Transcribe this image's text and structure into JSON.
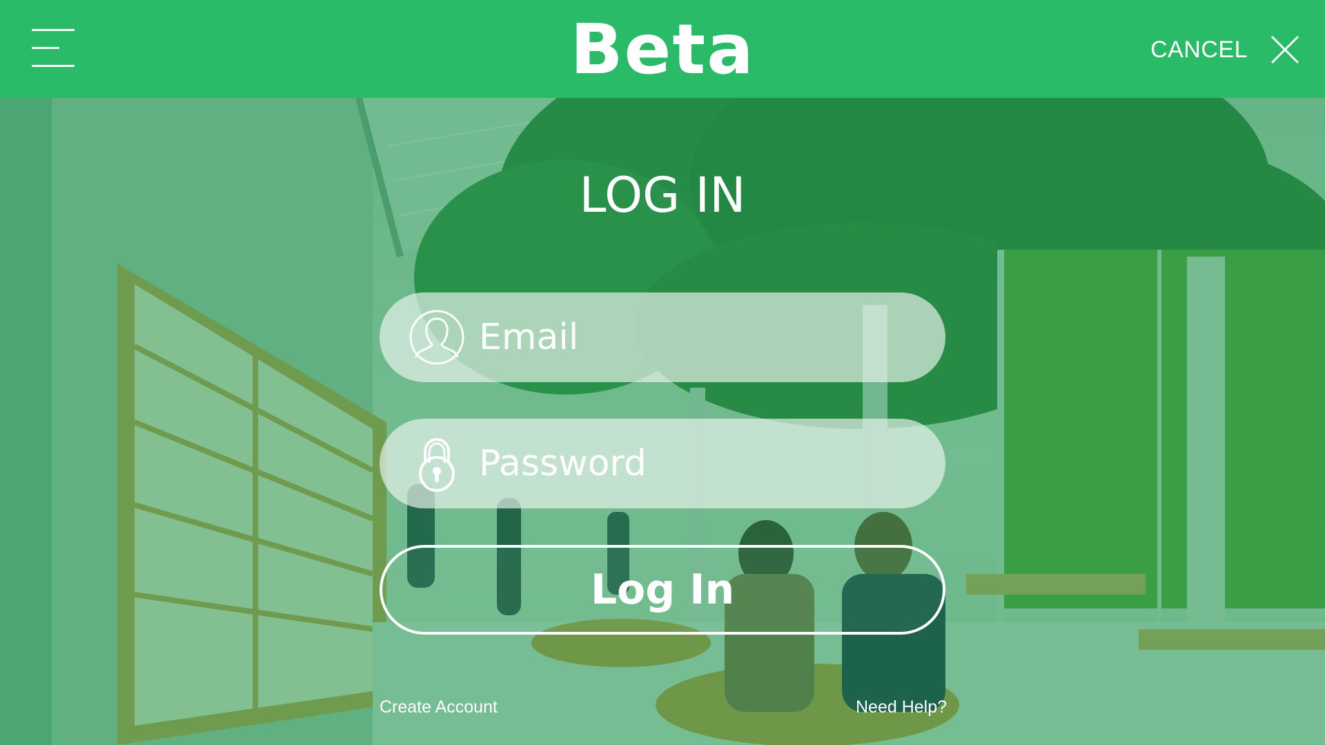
{
  "header": {
    "brand": "Beta",
    "cancel_label": "CANCEL",
    "menu_icon": "hamburger-menu-icon",
    "close_icon": "close-icon",
    "background_color": "#2abb68"
  },
  "login": {
    "title": "LOG IN",
    "email": {
      "placeholder": "Email",
      "value": "",
      "icon": "user-silhouette-icon"
    },
    "password": {
      "placeholder": "Password",
      "value": "",
      "icon": "padlock-icon"
    },
    "submit_label": "Log In",
    "create_account_label": "Create Account",
    "help_label": "Need Help?"
  },
  "colors": {
    "accent": "#2abb68",
    "overlay_tint": "#1c9650",
    "text": "#ffffff"
  }
}
